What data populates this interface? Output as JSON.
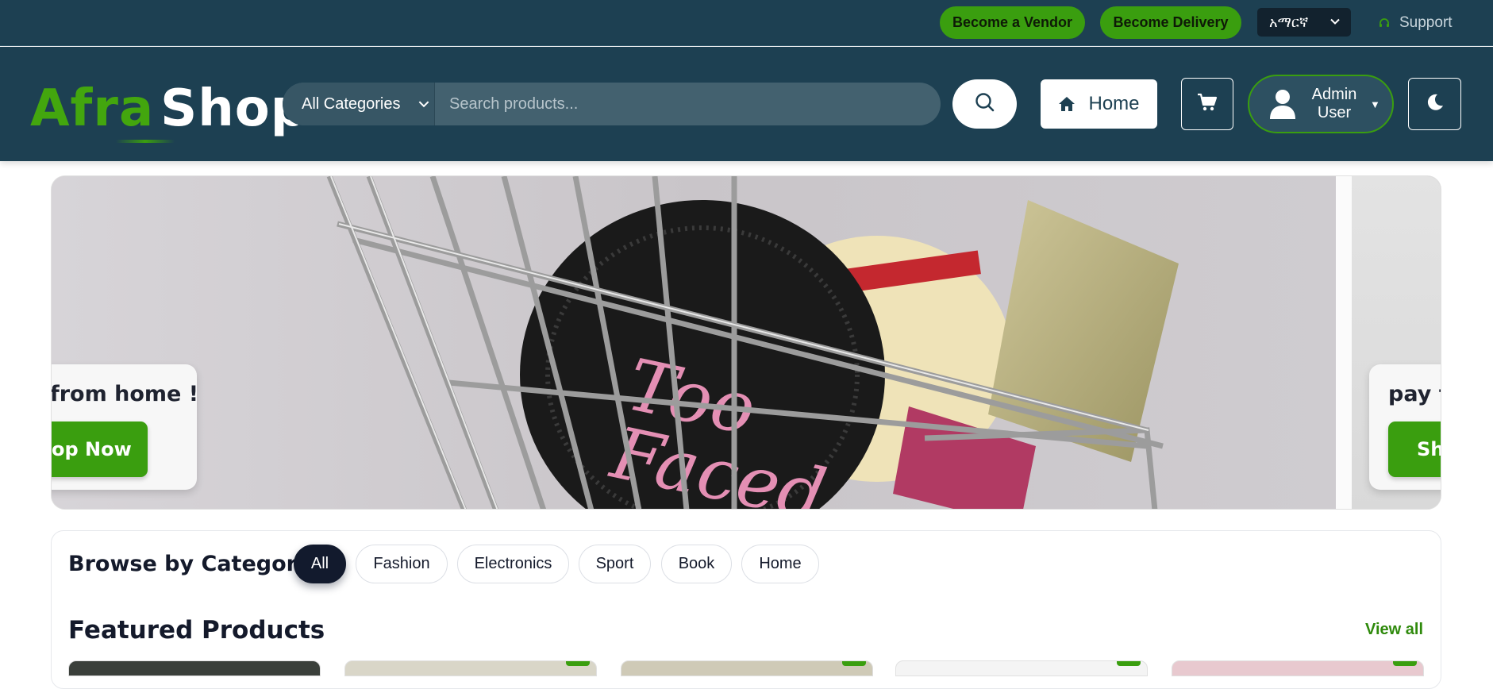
{
  "topbar": {
    "become_vendor": "Become a Vendor",
    "become_delivery": "Become Delivery",
    "language": "አማርኛ",
    "support": "Support"
  },
  "header": {
    "logo_part1": "Afra",
    "logo_part2": "Shop",
    "category_select": "All Categories",
    "search_placeholder": "Search products...",
    "home_label": "Home",
    "user_name_line1": "Admin",
    "user_name_line2": "User"
  },
  "banner": {
    "slide_current_text": "from home !",
    "slide_current_button": "op Now",
    "slide_next_text": "pay f",
    "slide_next_button": "Sh"
  },
  "browse": {
    "title": "Browse by Category",
    "categories": [
      "All",
      "Fashion",
      "Electronics",
      "Sport",
      "Book",
      "Home"
    ],
    "active_category": "All"
  },
  "featured": {
    "title": "Featured Products",
    "view_all": "View all"
  },
  "colors": {
    "header_bg": "#1d4052",
    "accent_green": "#3a9e0f",
    "dark_chip": "#121a2d"
  },
  "icons": {
    "support": "headset-icon",
    "search": "search-icon",
    "home": "home-icon",
    "cart": "cart-icon",
    "user": "user-icon",
    "theme": "moon-icon"
  }
}
